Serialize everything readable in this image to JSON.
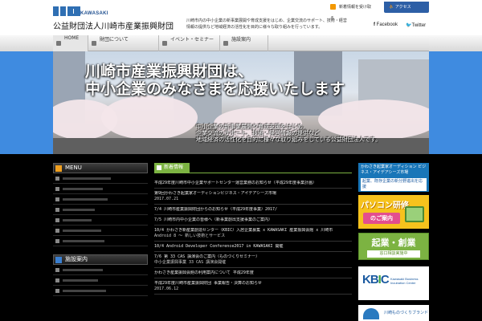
{
  "header": {
    "logo_text": "KAWASAKI",
    "org_name": "公益財団法人川崎市産業振興財団",
    "tagline": "川崎市内の中小企業の新事業展開や育成支援をはじめ、企業交流のサポート、技術・経営情報の提供など地域経済の活性化を目的に様々な取り組みを行っています。",
    "rss_label": "新着情報を受け取る",
    "access_label": "アクセス",
    "facebook_label": "Facebook",
    "twitter_label": "Twitter"
  },
  "nav": {
    "items": [
      {
        "label": "HOME"
      },
      {
        "label": "財団について"
      },
      {
        "label": "イベント・セミナー"
      },
      {
        "label": "施設案内"
      }
    ]
  },
  "hero": {
    "line1": "川崎市産業振興財団は、",
    "line2": "中小企業のみなさまを応援いたします",
    "desc1": "中小企業の新事業展開や育成支援をはじめ、",
    "desc2": "企業交流のサポート、技術・経営情報の提供など",
    "desc3": "地域経済の活性化を目的に様々な取り組みをしている公益財団法人です。"
  },
  "menu": {
    "title": "MENU",
    "title2": "施設案内"
  },
  "news": {
    "title": "新着情報",
    "items": [
      {
        "text": "平成29年度川崎市中小企業サポートセンター運営業務のお知らせ（平成29年度事業計画）",
        "date": ""
      },
      {
        "text": "第9回かわさき起業家オーディションビジネス・アイデアシーズ市場",
        "date": "2017.07.21"
      },
      {
        "text": "7/4 川崎市産業振興財団からのお知らせ（平成29年度事業）2017/",
        "date": ""
      },
      {
        "text": "7/5 川崎市内中小企業の皆様へ（新事業創出支援事業のご案内）",
        "date": ""
      },
      {
        "text": "10/4 かわさき新産業創造センター（KBIC）入居企業募集 x KAWASAKI 産業振興会館 x 川崎市",
        "date": "Android 8 ～ 新しい技術とサービス"
      },
      {
        "text": "10/4 Android Developer Conference2017 in KAWASAKI 開催",
        "date": ""
      },
      {
        "text": "7/6 第 33 CAS 講演会のご案内（ものづくりセミナー）",
        "date": "中小企業振興事業 33 CAS 講演会開催"
      },
      {
        "text": "かわさき産業振興会館の利用案内について 平成29年度",
        "date": ""
      },
      {
        "text": "平成29年度川崎市産業振興財団 事業報告・決算のお知らせ",
        "date": "2017.06.12"
      }
    ]
  },
  "banners": {
    "b1_text": "かわさき起業家オーディション ビジネス・アイデアシーズ市場",
    "b1_sub": "起業、既存企業の新分野進出を応援",
    "b2_big": "パソコン研修",
    "b2_small": "のご案内",
    "b3_big": "起業・創業",
    "b3_strip": "窓口相談実施中",
    "b4_logo": "KBIC",
    "b4_sub": "Kawasaki Business Incubation Center",
    "b5_text": "川崎ものづくりブランド"
  }
}
